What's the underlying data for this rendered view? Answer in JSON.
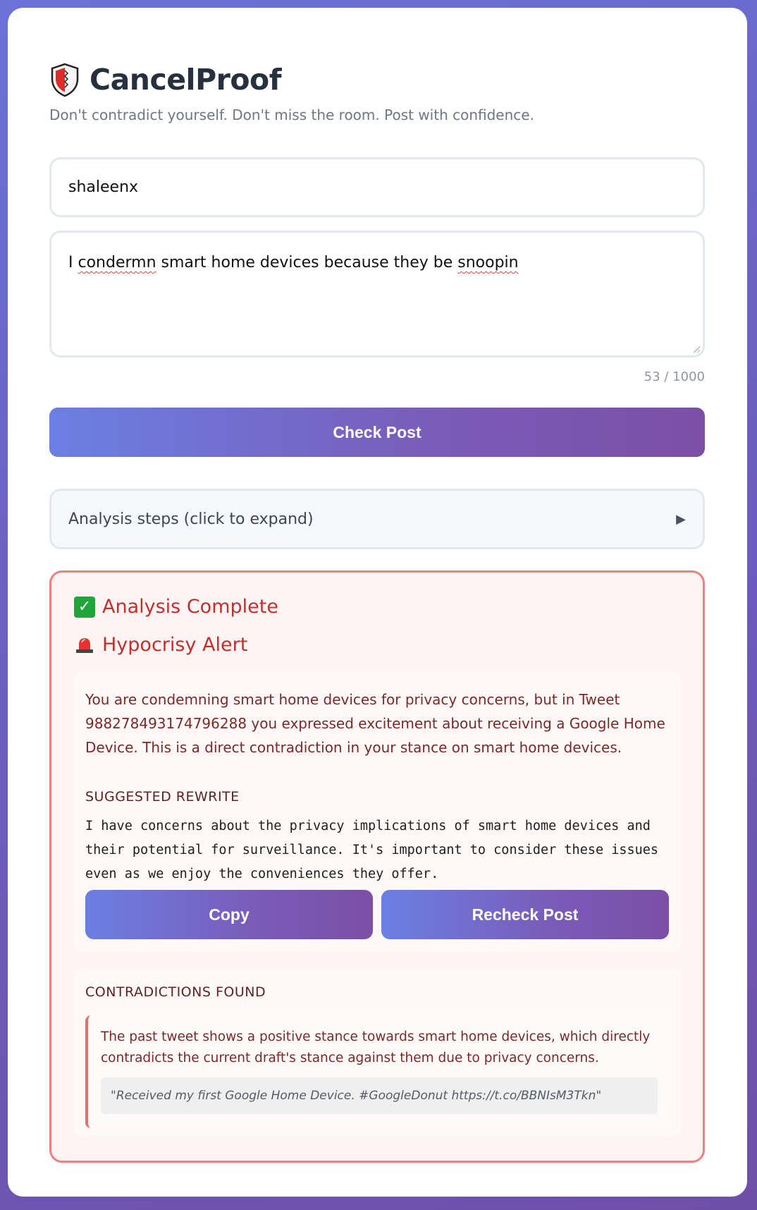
{
  "app": {
    "title": "CancelProof",
    "tagline": "Don't contradict yourself. Don't miss the room. Post with confidence."
  },
  "form": {
    "username": "shaleenx",
    "draft_before": "I ",
    "draft_word1": "condermn",
    "draft_middle": " smart home devices because they be ",
    "draft_word2": "snoopin",
    "char_count": "53 / 1000",
    "check_label": "Check Post"
  },
  "steps": {
    "label": "Analysis steps (click to expand)",
    "arrow": "▶"
  },
  "result": {
    "complete_label": "Analysis Complete",
    "alert_label": "Hypocrisy Alert",
    "explanation": "You are condemning smart home devices for privacy concerns, but in Tweet 988278493174796288 you expressed excitement about receiving a Google Home Device. This is a direct contradiction in your stance on smart home devices.",
    "rewrite_heading": "SUGGESTED REWRITE",
    "rewrite_text": "I have concerns about the privacy implications of smart home devices and their potential for surveillance. It's important to consider these issues even as we enjoy the conveniences they offer.",
    "copy_label": "Copy",
    "recheck_label": "Recheck Post",
    "contradictions_heading": "CONTRADICTIONS FOUND",
    "contradictions": [
      {
        "explanation": "The past tweet shows a positive stance towards smart home devices, which directly contradicts the current draft's stance against them due to privacy concerns.",
        "quote": "\"Received my first Google Home Device. #GoogleDonut https://t.co/BBNIsM3Tkn\""
      }
    ]
  },
  "icons": {
    "logo": "shield-icon",
    "complete": "check-mark-icon",
    "alert": "siren-icon",
    "expand": "triangle-right-icon"
  },
  "colors": {
    "accent_start": "#6b7fe3",
    "accent_end": "#7b4fa6",
    "alert_red": "#c0302c",
    "alert_border": "#ee8080"
  }
}
